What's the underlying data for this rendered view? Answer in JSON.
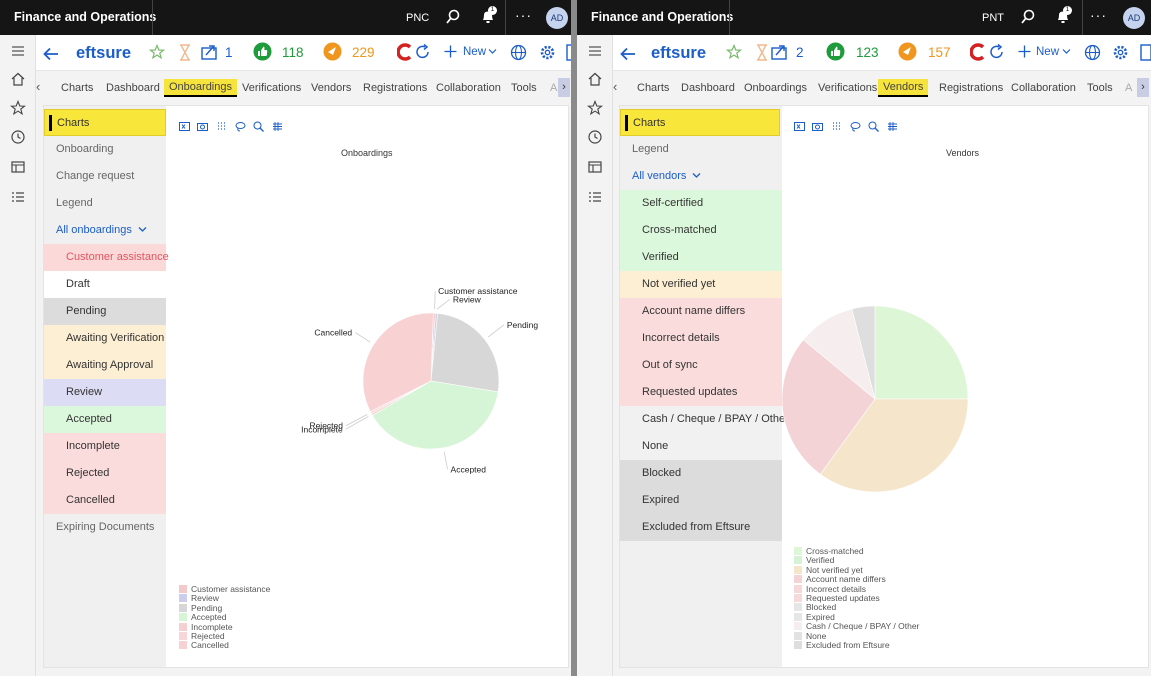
{
  "app_title": "Finance and Operations",
  "left": {
    "company": "PNC",
    "user_initials": "AD",
    "notification_count": "1",
    "product": "eftsure",
    "counter_share": "1",
    "counter_green": "118",
    "counter_orange": "229",
    "new_label": "New",
    "tabs": [
      "Charts",
      "Dashboard",
      "Onboardings",
      "Verifications",
      "Vendors",
      "Registrations",
      "Collaboration",
      "Tools",
      "A"
    ],
    "selected_tab": "Onboardings",
    "nav": {
      "charts": "Charts",
      "onboarding": "Onboarding",
      "change_request": "Change request",
      "legend": "Legend",
      "filter": "All onboardings",
      "statuses": [
        "Customer assistance",
        "Draft",
        "Pending",
        "Awaiting Verification",
        "Awaiting Approval",
        "Review",
        "Accepted",
        "Incomplete",
        "Rejected",
        "Cancelled"
      ],
      "expiring": "Expiring Documents"
    },
    "chart_title": "Onboardings",
    "pie_labels": [
      "Customer assistance",
      "Review",
      "Pending",
      "Accepted",
      "Incomplete",
      "Rejected",
      "Cancelled"
    ],
    "legend": [
      "Customer assistance",
      "Review",
      "Pending",
      "Accepted",
      "Incomplete",
      "Rejected",
      "Cancelled"
    ]
  },
  "right": {
    "company": "PNT",
    "user_initials": "AD",
    "notification_count": "1",
    "product": "eftsure",
    "counter_share": "2",
    "counter_green": "123",
    "counter_orange": "157",
    "new_label": "New",
    "tabs": [
      "Charts",
      "Dashboard",
      "Onboardings",
      "Verifications",
      "Vendors",
      "Registrations",
      "Collaboration",
      "Tools",
      "A"
    ],
    "selected_tab": "Vendors",
    "nav": {
      "charts": "Charts",
      "legend": "Legend",
      "filter": "All vendors",
      "statuses": [
        "Self-certified",
        "Cross-matched",
        "Verified",
        "Not verified yet",
        "Account name differs",
        "Incorrect details",
        "Out of sync",
        "Requested updates",
        "Cash / Cheque / BPAY / Other",
        "None",
        "Blocked",
        "Expired",
        "Excluded from Eftsure"
      ]
    },
    "chart_title": "Vendors",
    "legend": [
      "Cross-matched",
      "Verified",
      "Not verified yet",
      "Account name differs",
      "Incorrect details",
      "Requested updates",
      "Blocked",
      "Expired",
      "Cash / Cheque / BPAY / Other",
      "None",
      "Excluded from Eftsure"
    ]
  },
  "colors": {
    "customer_assistance": "#fbd9d9",
    "draft": "#ffffff",
    "pending": "#dcdcdc",
    "awaiting": "#fdefd3",
    "review": "#dcdcf4",
    "accepted": "#dcf8dc",
    "rejected_group": "#fbdcdc",
    "accent_yellow": "#f8e63a",
    "brand_blue": "#1b5dc9"
  },
  "chart_data": [
    {
      "type": "pie",
      "title": "Onboardings",
      "categories": [
        "Customer assistance",
        "Review",
        "Pending",
        "Accepted",
        "Incomplete",
        "Rejected",
        "Cancelled"
      ],
      "values": [
        0.5,
        0.5,
        26,
        39,
        0.5,
        0.5,
        33
      ],
      "colors": [
        "#f3c9c9",
        "#ccccec",
        "#d7d7d7",
        "#d6f5d6",
        "#f6d0d0",
        "#f8d6d6",
        "#f8d2d2"
      ],
      "legend_position": "bottom-left"
    },
    {
      "type": "pie",
      "title": "Vendors",
      "categories": [
        "Cross-matched",
        "Verified",
        "Not verified yet",
        "Account name differs",
        "Incorrect details",
        "Requested updates",
        "Blocked",
        "Expired",
        "Cash / Cheque / BPAY / Other",
        "None",
        "Excluded from Eftsure"
      ],
      "values": [
        25,
        0,
        35,
        26,
        0,
        0,
        0,
        0,
        10,
        0,
        4
      ],
      "colors": [
        "#dcf6d6",
        "#d6f2d6",
        "#f5e6cb",
        "#f4d3d6",
        "#f5d8d8",
        "#f5dada",
        "#e6e6e6",
        "#e6e6e6",
        "#f6eeee",
        "#e2e2e2",
        "#dedede"
      ],
      "legend_position": "bottom-left"
    }
  ]
}
